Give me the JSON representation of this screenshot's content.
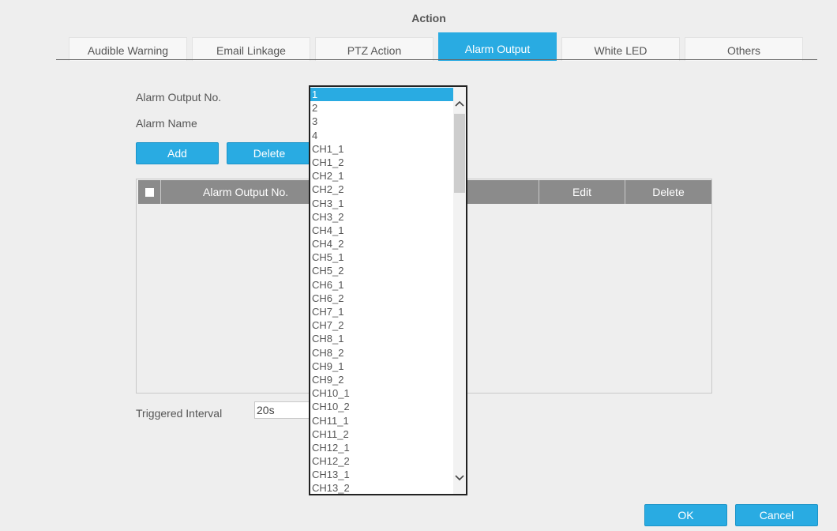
{
  "page_title": "Action",
  "tabs": [
    {
      "label": "Audible Warning"
    },
    {
      "label": "Email Linkage"
    },
    {
      "label": "PTZ Action"
    },
    {
      "label": "Alarm Output"
    },
    {
      "label": "White LED"
    },
    {
      "label": "Others"
    }
  ],
  "active_tab": "Alarm Output",
  "form": {
    "alarm_output_no_label": "Alarm Output No.",
    "alarm_name_label": "Alarm Name",
    "triggered_interval_label": "Triggered Interval",
    "triggered_interval_value": "20s"
  },
  "buttons": {
    "add": "Add",
    "delete": "Delete",
    "ok": "OK",
    "cancel": "Cancel"
  },
  "table": {
    "columns": [
      "Alarm Output No.",
      "Edit",
      "Delete"
    ],
    "rows": []
  },
  "dropdown": {
    "selected": "1",
    "options": [
      "1",
      "2",
      "3",
      "4",
      "CH1_1",
      "CH1_2",
      "CH2_1",
      "CH2_2",
      "CH3_1",
      "CH3_2",
      "CH4_1",
      "CH4_2",
      "CH5_1",
      "CH5_2",
      "CH6_1",
      "CH6_2",
      "CH7_1",
      "CH7_2",
      "CH8_1",
      "CH8_2",
      "CH9_1",
      "CH9_2",
      "CH10_1",
      "CH10_2",
      "CH11_1",
      "CH11_2",
      "CH12_1",
      "CH12_2",
      "CH13_1",
      "CH13_2"
    ]
  },
  "colors": {
    "accent": "#29abe2",
    "table_header": "#8b8b8b",
    "background": "#eeeeee"
  }
}
